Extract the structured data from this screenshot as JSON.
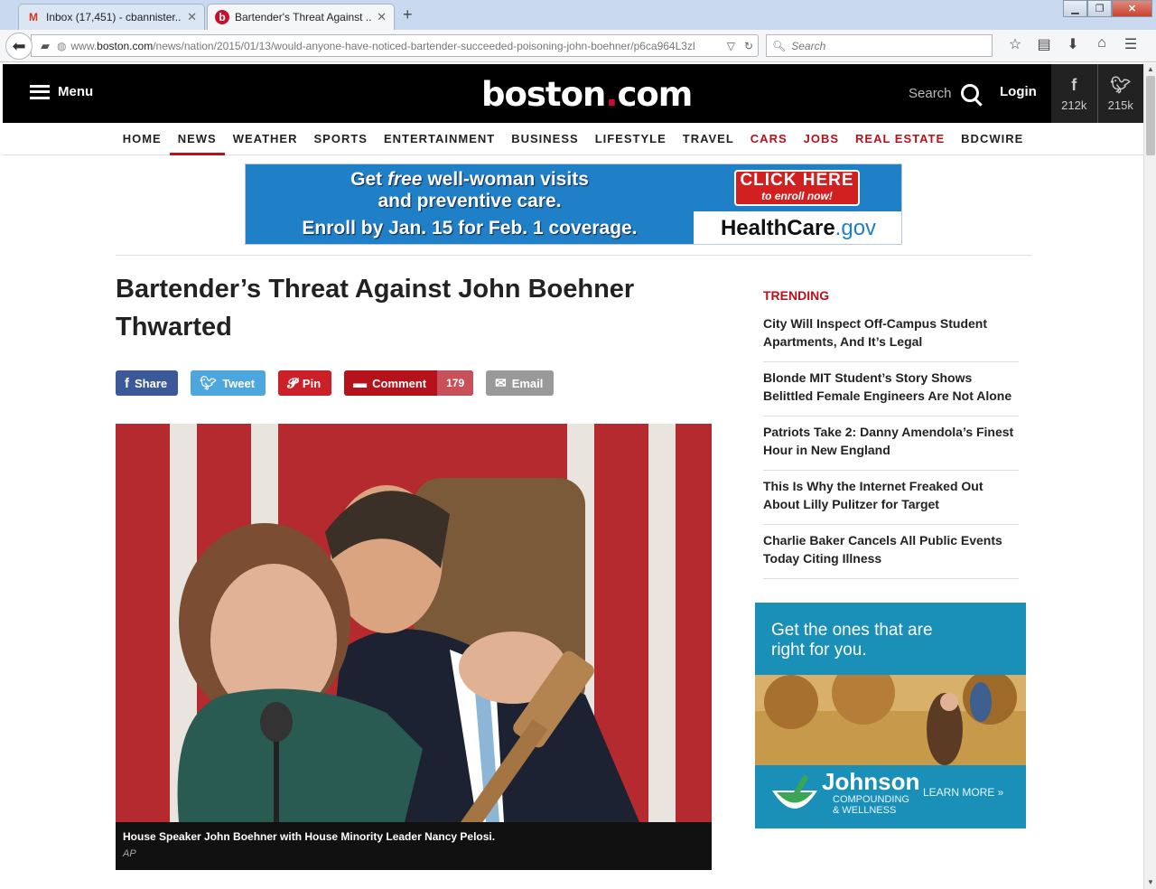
{
  "browser": {
    "tabs": [
      {
        "title": "Inbox (17,451) - cbannister...",
        "favicon": "M"
      },
      {
        "title": "Bartender's Threat Against ...",
        "favicon": "b"
      }
    ],
    "url_prefix": "www.",
    "url_domain": "boston.com",
    "url_path": "/news/nation/2015/01/13/would-anyone-have-noticed-bartender-succeeded-poisoning-john-boehner/p6ca964L3zl",
    "search_placeholder": "Search"
  },
  "header": {
    "menu_label": "Menu",
    "logo_main": "boston",
    "logo_dot": ".",
    "logo_tld": "com",
    "search_label": "Search",
    "login_label": "Login",
    "facebook_count": "212k",
    "twitter_count": "215k"
  },
  "nav": [
    {
      "label": "HOME",
      "red": false,
      "active": false
    },
    {
      "label": "NEWS",
      "red": false,
      "active": true
    },
    {
      "label": "WEATHER",
      "red": false,
      "active": false
    },
    {
      "label": "SPORTS",
      "red": false,
      "active": false
    },
    {
      "label": "ENTERTAINMENT",
      "red": false,
      "active": false
    },
    {
      "label": "BUSINESS",
      "red": false,
      "active": false
    },
    {
      "label": "LIFESTYLE",
      "red": false,
      "active": false
    },
    {
      "label": "TRAVEL",
      "red": false,
      "active": false
    },
    {
      "label": "CARS",
      "red": true,
      "active": false
    },
    {
      "label": "JOBS",
      "red": true,
      "active": false
    },
    {
      "label": "REAL ESTATE",
      "red": true,
      "active": false
    },
    {
      "label": "BDCWIRE",
      "red": false,
      "active": false
    }
  ],
  "top_ad": {
    "line1a": "Get ",
    "line1b": "free",
    "line1c": " well-woman visits",
    "line2": "and preventive care.",
    "line3": "Enroll by Jan. 15 for Feb. 1 coverage.",
    "cta_line1": "CLICK HERE",
    "cta_line2": "to enroll now!",
    "brand_main": "HealthCare",
    "brand_tld": ".gov"
  },
  "article": {
    "headline": "Bartender’s Threat Against John Boehner Thwarted",
    "share": {
      "facebook": "Share",
      "twitter": "Tweet",
      "pinterest": "Pin",
      "comment": "Comment",
      "comment_count": "179",
      "email": "Email"
    },
    "caption": "House Speaker John Boehner with House Minority Leader Nancy Pelosi.",
    "credit": "AP"
  },
  "trending": {
    "heading": "TRENDING",
    "items": [
      "City Will Inspect Off-Campus Student Apartments, And It’s Legal",
      "Blonde MIT Student’s Story Shows Belittled Female Engineers Are Not Alone",
      "Patriots Take 2: Danny Amendola’s Finest Hour in New England",
      "This Is Why the Internet Freaked Out About Lilly Pulitzer for Target",
      "Charlie Baker Cancels All Public Events Today Citing Illness"
    ]
  },
  "side_ad": {
    "title": "Get the ones that are right for you.",
    "brand": "Johnson",
    "sub1": "COMPOUNDING",
    "sub2": "& WELLNESS",
    "cta": "LEARN MORE »"
  },
  "colors": {
    "brand_red": "#b5121b",
    "header_bg": "#000000",
    "facebook": "#3b5998",
    "twitter": "#4da7de",
    "pinterest": "#cb2027"
  },
  "icons": [
    "back-arrow-icon",
    "star-icon",
    "download-icon",
    "home-icon",
    "hamburger-icon",
    "search-icon",
    "facebook-icon",
    "twitter-icon",
    "pinterest-icon",
    "comment-icon",
    "email-icon"
  ]
}
